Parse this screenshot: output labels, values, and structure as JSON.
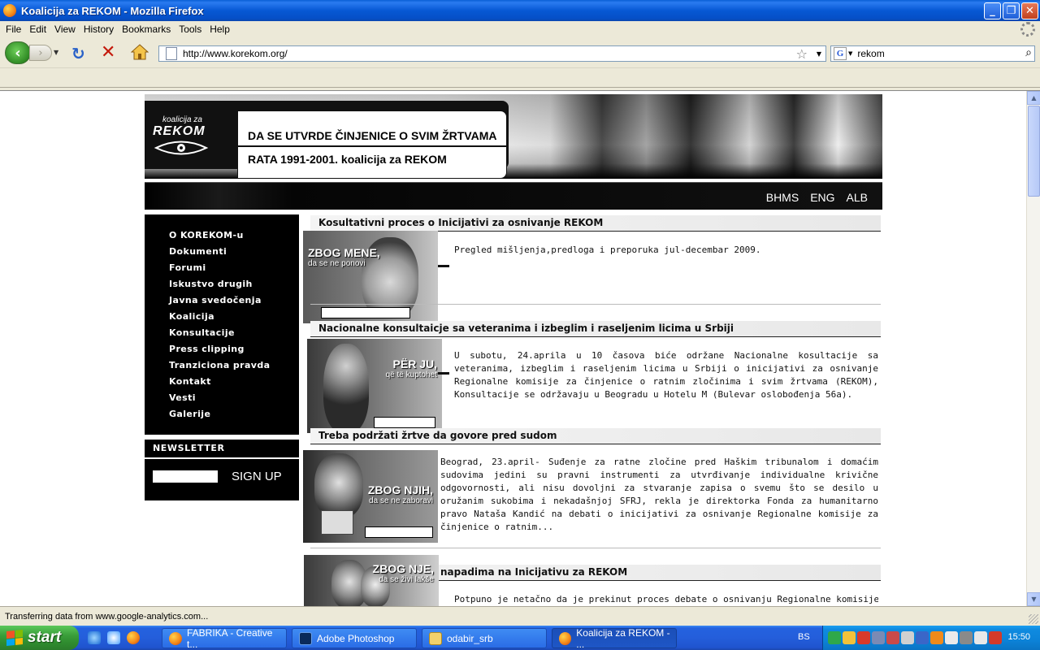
{
  "window": {
    "title": "Koalicija za REKOM - Mozilla Firefox"
  },
  "menu": [
    "File",
    "Edit",
    "View",
    "History",
    "Bookmarks",
    "Tools",
    "Help"
  ],
  "nav": {
    "url": "http://www.korekom.org/",
    "search_value": "rekom"
  },
  "site": {
    "logo_small": "koalicija za",
    "logo_big": "REKOM",
    "tagline1": "DA SE UTVRDE ČINJENICE O SVIM ŽRTVAMA",
    "tagline2": "RATA 1991-2001.  koalicija za REKOM",
    "languages": [
      "BHMS",
      "ENG",
      "ALB"
    ],
    "menu_items": [
      "O KOREKOM-u",
      "Dokumenti",
      "Forumi",
      "Iskustvo drugih",
      "Javna svedočenja",
      "Koalicija",
      "Konsultacije",
      "Press clipping",
      "Tranziciona pravda",
      "Kontakt",
      "Vesti",
      "Galerije"
    ],
    "newsletter_label": "NEWSLETTER",
    "signup_label": "SIGN UP"
  },
  "articles": [
    {
      "title": "Kosultativni proces o Inicijativi za osnivanje REKOM",
      "img_main": "ZBOG MENE,",
      "img_sub": "da se ne ponovi",
      "body": "Pregled mišljenja,predloga i preporuka jul-decembar 2009."
    },
    {
      "title": "Nacionalne konsultaicje sa veteranima i izbeglim i raseljenim licima u Srbiji",
      "img_main": "PËR JU,",
      "img_sub": "që të kuptohet",
      "body": "U subotu, 24.aprila u 10 časova biće održane Nacionalne kosultacije sa veteranima, izbeglim i raseljenim licima u Srbiji o inicijativi za osnivanje Regionalne komisije za činjenice o ratnim zločinima i svim žrtvama (REKOM), Konsultacije se održavaju u Beogradu u Hotelu M (Bulevar oslobođenja 56a)."
    },
    {
      "title": "Treba podržati žrtve da govore pred sudom",
      "img_main": "ZBOG NJIH,",
      "img_sub": "da se ne zaboravi",
      "body": "Beograd, 23.april- Suđenje za ratne zločine pred Haškim tribunalom i domaćim sudovima jedini su pravni instrumenti za utvrđivanje individualne krivične odgovornosti, ali nisu dovoljni za stvaranje zapisa o svemu što se desilo u oružanim sukobima i nekadašnjoj SFRJ, rekla je direktorka Fonda za humanitarno pravo Nataša Kandić na debati o inicijativi za osnivanje Regionalne komisije za činjenice o ratnim..."
    },
    {
      "title": "napadima na Inicijativu za REKOM",
      "img_main": "ZBOG NJE,",
      "img_sub": "da se živi lakše",
      "body": "Potpuno je netačno da je prekinut proces debate o osnivanju Regionalne komisije"
    }
  ],
  "status": "Transferring data from www.google-analytics.com...",
  "taskbar": {
    "start": "start",
    "tasks": [
      "FABRIKA - Creative t...",
      "Adobe Photoshop",
      "odabir_srb",
      "Koalicija za REKOM - ..."
    ],
    "lang": "BS",
    "clock": "15:50"
  }
}
